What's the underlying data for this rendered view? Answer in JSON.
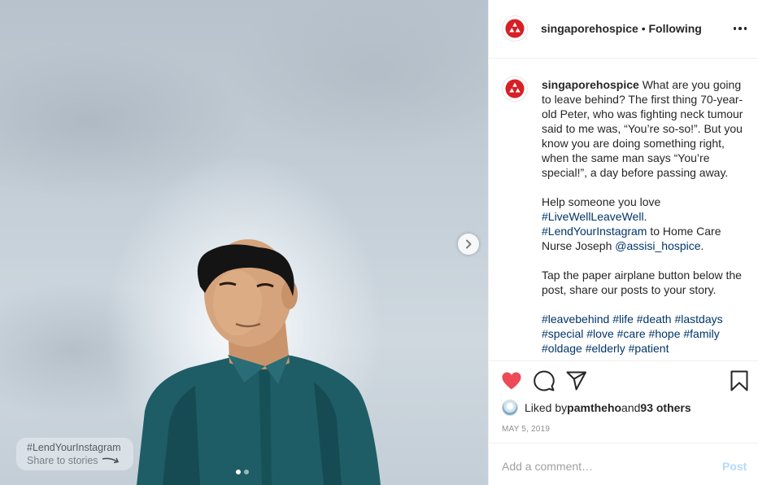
{
  "photo": {
    "share_badge": {
      "tag": "#LendYourInstagram",
      "subtitle": "Share to stories"
    },
    "carousel": {
      "current": 1,
      "total": 2
    }
  },
  "header": {
    "username": "singaporehospice",
    "separator": " • ",
    "follow_status": "Following"
  },
  "caption": {
    "username": "singaporehospice",
    "paragraph1": "What are you going to leave behind? The first thing 70-year-old Peter, who was fighting neck tumour said to me was, “You’re so-so!”. But you know you are doing something right, when the same man says “You’re special!”, a day before passing away.",
    "p2_text": "Help someone you love",
    "p2_tag1": "#LiveWellLeaveWell",
    "p2_dot": ".",
    "p2_tag2": "#LendYourInstagram",
    "p2_mid": " to Home Care Nurse Joseph ",
    "p2_mention": "@assisi_hospice",
    "p2_end": ".",
    "paragraph3": "Tap the paper airplane button below the post, share our posts to your story.",
    "hashtags": [
      "#leavebehind",
      "#life",
      "#death",
      "#lastdays",
      "#special",
      "#love",
      "#care",
      "#hope",
      "#family",
      "#oldage",
      "#elderly",
      "#patient"
    ]
  },
  "likes": {
    "prefix": "Liked by ",
    "user": "pamtheho",
    "middle": " and ",
    "others": "93 others"
  },
  "date": "MAY 5, 2019",
  "comment": {
    "placeholder": "Add a comment…",
    "post_label": "Post"
  },
  "colors": {
    "like_red": "#ed4956",
    "link_blue": "#003569",
    "post_button": "#b3dbff",
    "logo_red": "#d71f26"
  },
  "icons": [
    "heart-icon",
    "comment-icon",
    "share-icon",
    "bookmark-icon",
    "more-icon",
    "chevron-right-icon"
  ]
}
